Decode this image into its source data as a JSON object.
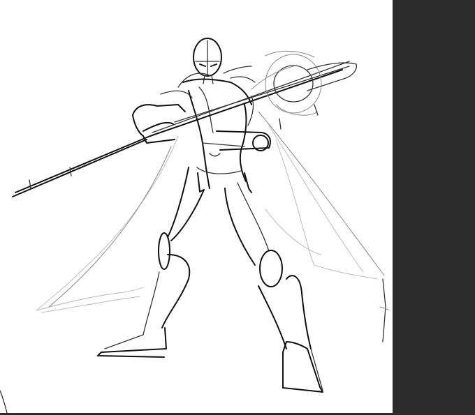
{
  "app": {
    "canvas": {
      "background": "#ffffff",
      "artwork": "sketch"
    },
    "panel": {
      "background": "#2b2b2b"
    },
    "stroke_color": "#111111"
  }
}
